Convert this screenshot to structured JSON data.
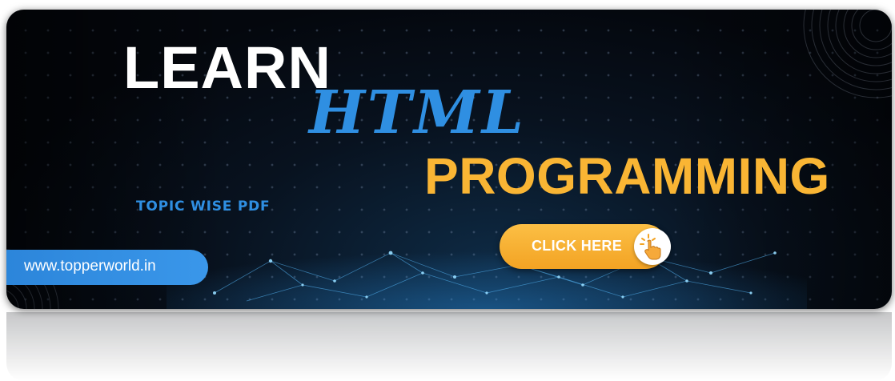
{
  "banner": {
    "title_line1": "LEARN",
    "title_line2": "HTML",
    "title_line3": "PROGRAMMING",
    "subtitle": "TOPIC WISE PDF",
    "website": "www.topperworld.in",
    "cta_label": "CLICK HERE"
  },
  "colors": {
    "background": "#05090f",
    "accent_blue": "#2f8fe2",
    "accent_orange": "#f9b534",
    "text_white": "#ffffff"
  },
  "icons": {
    "cta": "hand-pointer-click-icon"
  }
}
